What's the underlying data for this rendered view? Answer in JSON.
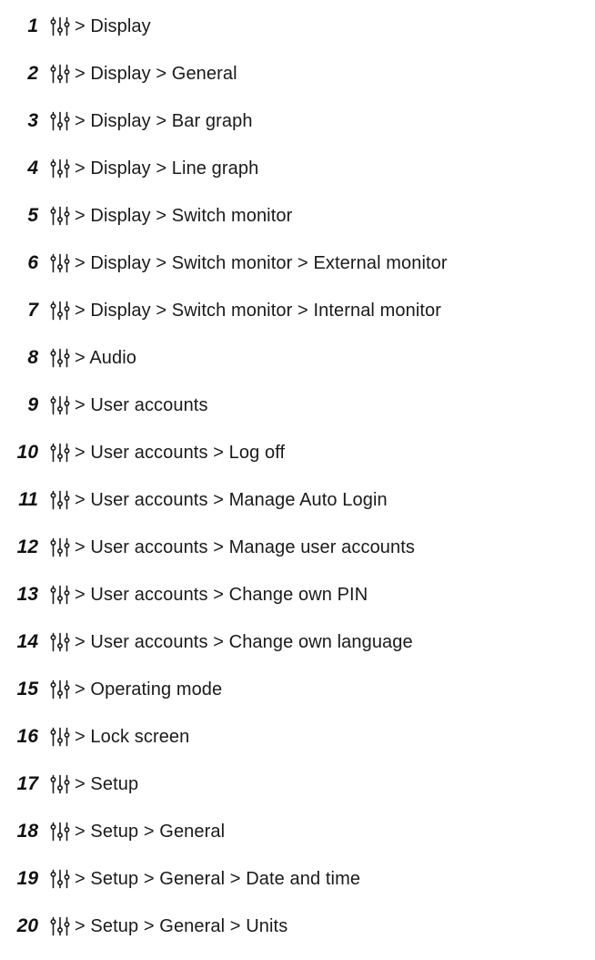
{
  "icon": {
    "name": "settings-sliders-icon",
    "color": "#1a1a1a"
  },
  "items": [
    {
      "number": "1",
      "path": "> Display"
    },
    {
      "number": "2",
      "path": "> Display > General"
    },
    {
      "number": "3",
      "path": "> Display > Bar graph"
    },
    {
      "number": "4",
      "path": "> Display > Line graph"
    },
    {
      "number": "5",
      "path": "> Display > Switch monitor"
    },
    {
      "number": "6",
      "path": "> Display > Switch monitor > External monitor"
    },
    {
      "number": "7",
      "path": "> Display > Switch monitor > Internal monitor"
    },
    {
      "number": "8",
      "path": "> Audio"
    },
    {
      "number": "9",
      "path": "> User accounts"
    },
    {
      "number": "10",
      "path": "> User accounts > Log off"
    },
    {
      "number": "11",
      "path": "> User accounts > Manage Auto Login"
    },
    {
      "number": "12",
      "path": "> User accounts > Manage user accounts"
    },
    {
      "number": "13",
      "path": "> User accounts > Change own PIN"
    },
    {
      "number": "14",
      "path": "> User accounts > Change own language"
    },
    {
      "number": "15",
      "path": "> Operating mode"
    },
    {
      "number": "16",
      "path": "> Lock screen"
    },
    {
      "number": "17",
      "path": "> Setup"
    },
    {
      "number": "18",
      "path": "> Setup > General"
    },
    {
      "number": "19",
      "path": "> Setup > General > Date and time"
    },
    {
      "number": "20",
      "path": "> Setup > General > Units"
    }
  ]
}
